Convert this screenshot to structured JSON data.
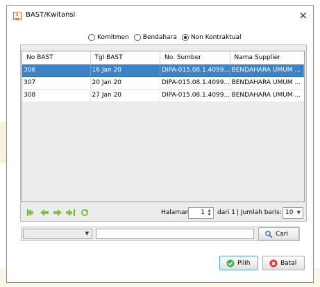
{
  "window": {
    "title": "BAST/Kwitansi",
    "close_glyph": "×",
    "icon": "java-app-icon"
  },
  "filter_radio": {
    "options": [
      {
        "label": "Komitmen",
        "selected": false
      },
      {
        "label": "Bendahara",
        "selected": false
      },
      {
        "label": "Non Kontraktual",
        "selected": true
      }
    ]
  },
  "table": {
    "columns": [
      "No BAST",
      "Tgl BAST",
      "No. Sumber",
      "Nama Supplier"
    ],
    "rows": [
      {
        "no_bast": "306",
        "tgl_bast": "16 Jan 20",
        "no_sumber": "DIPA-015.08.1.4099...",
        "nama_supplier": "BENDAHARA UMUM ...",
        "selected": true
      },
      {
        "no_bast": "307",
        "tgl_bast": "20 Jan 20",
        "no_sumber": "DIPA-015.08.1.4099...",
        "nama_supplier": "BENDAHARA UMUM ...",
        "selected": false
      },
      {
        "no_bast": "308",
        "tgl_bast": "27 Jan 20",
        "no_sumber": "DIPA-015.08.1.4099...",
        "nama_supplier": "BENDAHARA UMUM ...",
        "selected": false
      }
    ],
    "selection_color": "#3b83c8"
  },
  "pager": {
    "icons": [
      "first-page-icon",
      "previous-page-icon",
      "next-page-icon",
      "last-page-icon",
      "refresh-icon"
    ],
    "halaman_label": "Halaman",
    "page_value": "1",
    "of_label": "dari 1",
    "separator": "|",
    "rows_label": "Jumlah baris:",
    "rows_value": "10"
  },
  "search": {
    "field_value": "",
    "query_value": "",
    "cari_label": "Cari"
  },
  "buttons": {
    "pilih_label": "Pilih",
    "batal_label": "Batal",
    "pilih_icon_color": "#4caf50",
    "batal_icon_color": "#d9383a"
  }
}
